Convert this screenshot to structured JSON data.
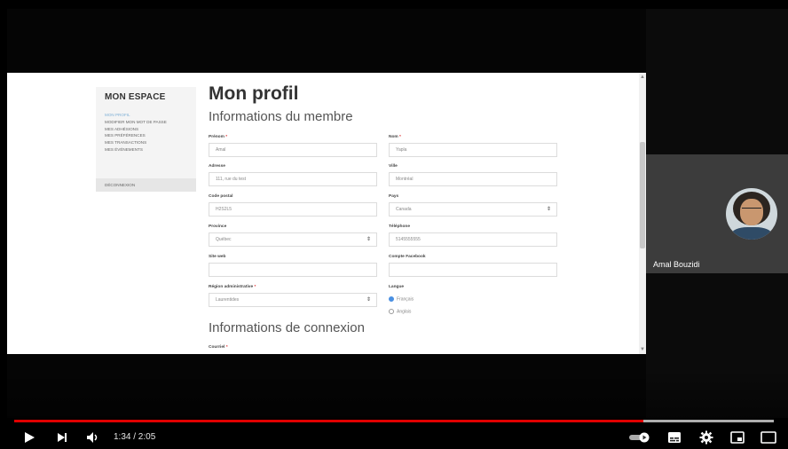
{
  "website": {
    "sidebar": {
      "title": "MON ESPACE",
      "links": [
        "MON PROFIL",
        "MODIFIER MON MOT DE PASSE",
        "MES ADHÉSIONS",
        "MES PRÉFÉRENCES",
        "MES TRANSACTIONS",
        "MES ÉVÉNEMENTS"
      ],
      "logout": "DÉCONNEXION"
    },
    "title": "Mon profil",
    "section_member": "Informations du membre",
    "section_login": "Informations de connexion",
    "required_mark": "*",
    "fields": {
      "prenom": {
        "label": "Prénom",
        "value": "Amal"
      },
      "nom": {
        "label": "Nom",
        "value": "Yapla"
      },
      "adresse": {
        "label": "Adresse",
        "value": "111, rue du test"
      },
      "ville": {
        "label": "Ville",
        "value": "Montréal"
      },
      "code_postal": {
        "label": "Code postal",
        "value": "H2S2L5"
      },
      "pays": {
        "label": "Pays",
        "value": "Canada"
      },
      "province": {
        "label": "Province",
        "value": "Québec"
      },
      "telephone": {
        "label": "Téléphone",
        "value": "5145555555"
      },
      "site_web": {
        "label": "Site web",
        "value": ""
      },
      "facebook": {
        "label": "Compte Facebook",
        "value": ""
      },
      "region": {
        "label": "Région administrative",
        "value": "Laurentides"
      },
      "langue": {
        "label": "Langue",
        "options": [
          "Français",
          "Anglais"
        ],
        "selected": "Français"
      },
      "courriel": {
        "label": "Courriel"
      }
    }
  },
  "participant": {
    "name": "Amal Bouzidi"
  },
  "player": {
    "time": "1:34 / 2:05",
    "progress_fraction": 0.828,
    "buffered_fraction": 1.0,
    "icons": [
      "play-icon",
      "next-icon",
      "volume-icon",
      "autoplay-toggle-icon",
      "subtitles-icon",
      "settings-icon",
      "miniplayer-icon",
      "theater-icon"
    ],
    "accent_color": "#e00000"
  }
}
